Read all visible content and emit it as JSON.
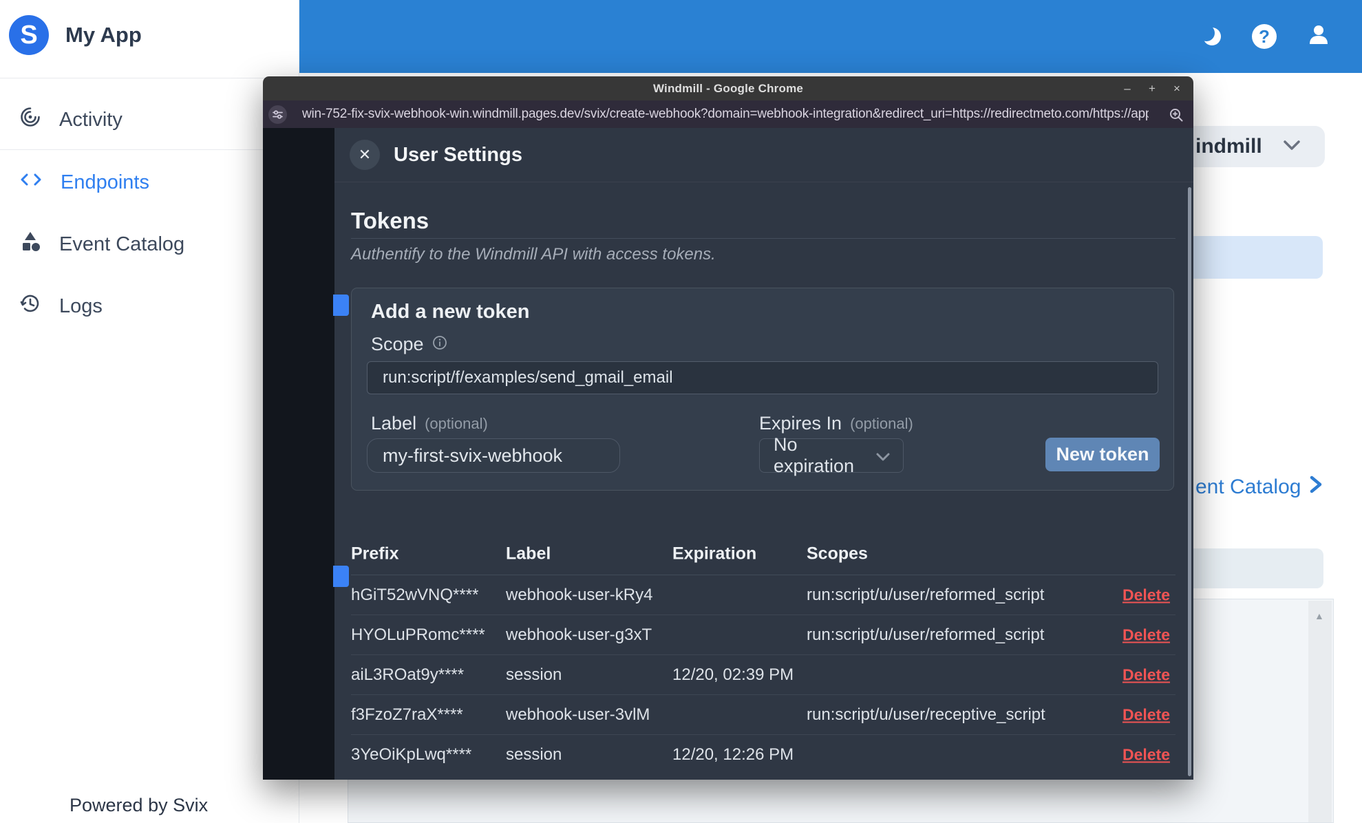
{
  "app": {
    "name": "My App",
    "logo_letter": "S",
    "powered_by": "Powered by Svix"
  },
  "sidebar": {
    "items": [
      {
        "label": "Activity",
        "icon": "target-icon",
        "active": false
      },
      {
        "label": "Endpoints",
        "icon": "code-icon",
        "active": true
      },
      {
        "label": "Event Catalog",
        "icon": "shapes-icon",
        "active": false
      },
      {
        "label": "Logs",
        "icon": "history-icon",
        "active": false
      }
    ]
  },
  "topbar": {
    "icons": [
      "moon-icon",
      "help-icon",
      "user-icon"
    ],
    "help_glyph": "?"
  },
  "background_page": {
    "workspace_dropdown_partial": "indmill",
    "event_catalog_link_partial": "ent Catalog"
  },
  "chrome": {
    "title": "Windmill - Google Chrome",
    "window_controls": [
      "–",
      "+",
      "×"
    ],
    "url": "win-752-fix-svix-webhook-win.windmill.pages.dev/svix/create-webhook?domain=webhook-integration&redirect_uri=https://redirectmeto.com/https://app...."
  },
  "modal": {
    "title": "User Settings",
    "close_glyph": "✕",
    "section_heading": "Tokens",
    "section_subtitle": "Authentify to the Windmill API with access tokens.",
    "form": {
      "heading": "Add a new token",
      "scope_label": "Scope",
      "scope_value": "run:script/f/examples/send_gmail_email",
      "label_label": "Label",
      "optional_hint": "(optional)",
      "label_value": "my-first-svix-webhook",
      "expires_label": "Expires In",
      "expires_value": "No expiration",
      "submit_label": "New token"
    },
    "table": {
      "headers": [
        "Prefix",
        "Label",
        "Expiration",
        "Scopes"
      ],
      "delete_label": "Delete",
      "rows": [
        {
          "prefix": "hGiT52wVNQ****",
          "label": "webhook-user-kRy4",
          "expiration": "",
          "scopes": "run:script/u/user/reformed_script"
        },
        {
          "prefix": "HYOLuPRomc****",
          "label": "webhook-user-g3xT",
          "expiration": "",
          "scopes": "run:script/u/user/reformed_script"
        },
        {
          "prefix": "aiL3ROat9y****",
          "label": "session",
          "expiration": "12/20, 02:39 PM",
          "scopes": ""
        },
        {
          "prefix": "f3FzoZ7raX****",
          "label": "webhook-user-3vlM",
          "expiration": "",
          "scopes": "run:script/u/user/receptive_script"
        },
        {
          "prefix": "3YeOiKpLwq****",
          "label": "session",
          "expiration": "12/20, 12:26 PM",
          "scopes": ""
        }
      ]
    }
  },
  "colors": {
    "topbar_blue": "#2a81d3",
    "accent_blue": "#2f7ff0",
    "button_blue": "#5f86b5",
    "delete_red": "#f05454",
    "modal_bg": "#2f3744"
  }
}
